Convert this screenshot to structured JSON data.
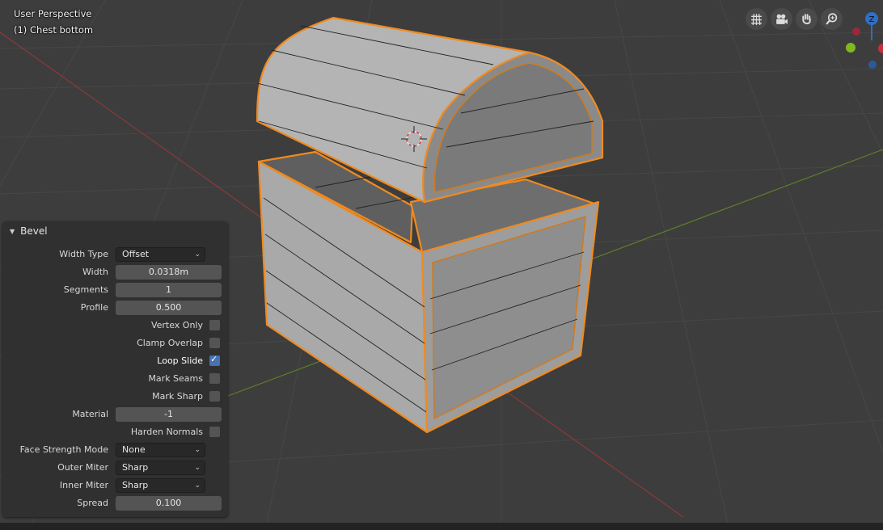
{
  "viewport": {
    "view_name": "User Perspective",
    "object_info": "(1) Chest bottom"
  },
  "nav_tools": [
    {
      "name": "toggle-ortho-grid-icon"
    },
    {
      "name": "camera-view-icon"
    },
    {
      "name": "pan-hand-icon"
    },
    {
      "name": "zoom-magnifier-icon"
    }
  ],
  "gizmo": {
    "z_label": "Z",
    "colors": {
      "x": "#c2303f",
      "y": "#7fb81f",
      "z": "#2d6fc9"
    }
  },
  "bevel_panel": {
    "title": "Bevel",
    "width_type_label": "Width Type",
    "width_type_value": "Offset",
    "width_label": "Width",
    "width_value": "0.0318m",
    "segments_label": "Segments",
    "segments_value": "1",
    "profile_label": "Profile",
    "profile_value": "0.500",
    "vertex_only_label": "Vertex Only",
    "vertex_only_checked": false,
    "clamp_overlap_label": "Clamp Overlap",
    "clamp_overlap_checked": false,
    "loop_slide_label": "Loop Slide",
    "loop_slide_checked": true,
    "mark_seams_label": "Mark Seams",
    "mark_seams_checked": false,
    "mark_sharp_label": "Mark Sharp",
    "mark_sharp_checked": false,
    "material_label": "Material",
    "material_value": "-1",
    "harden_normals_label": "Harden Normals",
    "harden_normals_checked": false,
    "face_strength_label": "Face Strength Mode",
    "face_strength_value": "None",
    "outer_miter_label": "Outer Miter",
    "outer_miter_value": "Sharp",
    "inner_miter_label": "Inner Miter",
    "inner_miter_value": "Sharp",
    "spread_label": "Spread",
    "spread_value": "0.100"
  },
  "colors": {
    "background": "#3d3d3d",
    "panel": "#303030",
    "selection_orange": "#f08a1f",
    "checkbox_on": "#4772b3"
  }
}
